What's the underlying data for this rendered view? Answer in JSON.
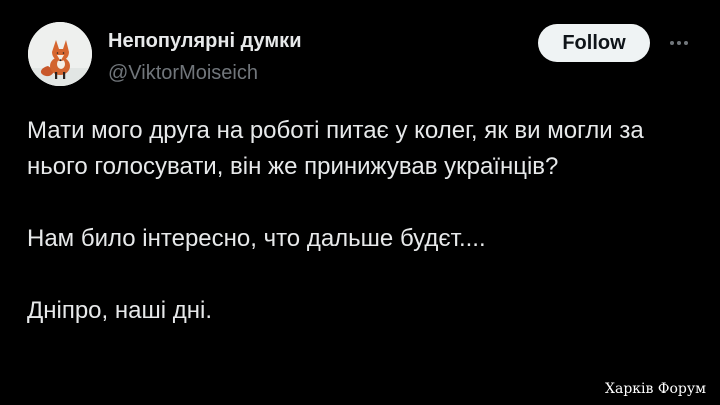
{
  "author": {
    "display_name": "Непопулярні думки",
    "handle": "@ViktorMoiseich",
    "avatar": "fox-in-snow-avatar"
  },
  "actions": {
    "follow_label": "Follow",
    "more_icon": "more-horizontal-icon"
  },
  "tweet": {
    "paragraphs": [
      "Мати мого друга на роботі питає у колег, як ви могли за нього голосувати, він же принижував українців?",
      "Нам било інтересно, что дальше будєт....",
      "Дніпро, наші дні."
    ]
  },
  "watermark": {
    "text": "Харків Форум"
  },
  "colors": {
    "background": "#000000",
    "primary_text": "#e7e9ea",
    "secondary_text": "#71767b",
    "follow_button_bg": "#eff3f4",
    "follow_button_text": "#0f1419"
  }
}
